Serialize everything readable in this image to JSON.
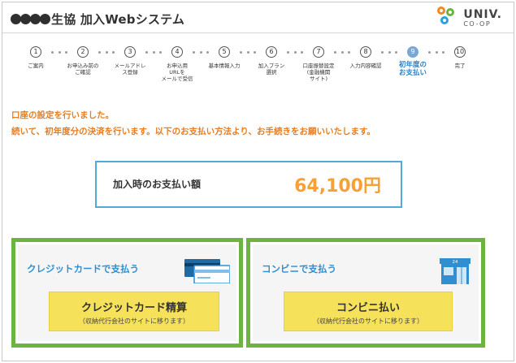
{
  "header": {
    "title": "生協 加入Webシステム",
    "logo_main": "UNIV.",
    "logo_sub": "CO-OP"
  },
  "steps": [
    {
      "num": "1",
      "label": "ご案内"
    },
    {
      "num": "2",
      "label": "お申込み前の\nご確認"
    },
    {
      "num": "3",
      "label": "メールアドレ\nス登録"
    },
    {
      "num": "4",
      "label": "お申込用\nURLを\nメールで受信"
    },
    {
      "num": "5",
      "label": "基本情報入力"
    },
    {
      "num": "6",
      "label": "加入プラン\n選択"
    },
    {
      "num": "7",
      "label": "口座振替設定\n(金融機関\nサイト)"
    },
    {
      "num": "8",
      "label": "入力内容確認"
    },
    {
      "num": "9",
      "label": "初年度の\nお支払い"
    },
    {
      "num": "10",
      "label": "完了"
    }
  ],
  "active_step": "9",
  "messages": {
    "line1": "口座の設定を行いました。",
    "line2": "続いて、初年度分の決済を行います。以下のお支払い方法より、お手続きをお願いいたします。"
  },
  "amount": {
    "label": "加入時のお支払い額",
    "value": "64,100円"
  },
  "payment_options": {
    "credit": {
      "title": "クレジットカードで支払う",
      "button_main": "クレジットカード精算",
      "button_sub": "（収納代行会社のサイトに移ります）",
      "icon": "credit-card-icon"
    },
    "convenience": {
      "title": "コンビニで支払う",
      "button_main": "コンビニ払い",
      "button_sub": "（収納代行会社のサイトに移ります）",
      "icon": "convenience-store-icon",
      "store_sign": "24"
    }
  },
  "colors": {
    "accent_orange": "#e67e22",
    "amount_orange": "#f5a137",
    "accent_blue": "#2f8fd0",
    "panel_green": "#6db33f",
    "button_yellow": "#f5e15a",
    "active_step_blue": "#7aa8d6"
  }
}
